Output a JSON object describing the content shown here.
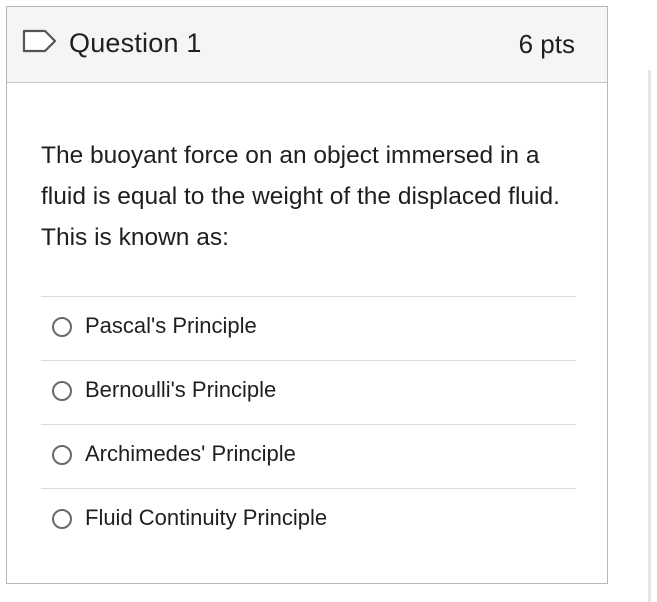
{
  "question": {
    "title": "Question 1",
    "points": "6 pts",
    "flag_icon": "flag-icon",
    "text": "The buoyant force on an object immersed in a fluid is equal to the weight of the displaced fluid. This is known as:",
    "answers": [
      {
        "label": "Pascal's Principle",
        "selected": false
      },
      {
        "label": "Bernoulli's Principle",
        "selected": false
      },
      {
        "label": "Archimedes' Principle",
        "selected": false
      },
      {
        "label": "Fluid Continuity Principle",
        "selected": false
      }
    ]
  },
  "colors": {
    "header_bg": "#f5f5f5",
    "border": "#b8b8b8",
    "text": "#1f1f1f",
    "radio_border": "#6a6a6a",
    "divider": "#dcdcdc"
  }
}
